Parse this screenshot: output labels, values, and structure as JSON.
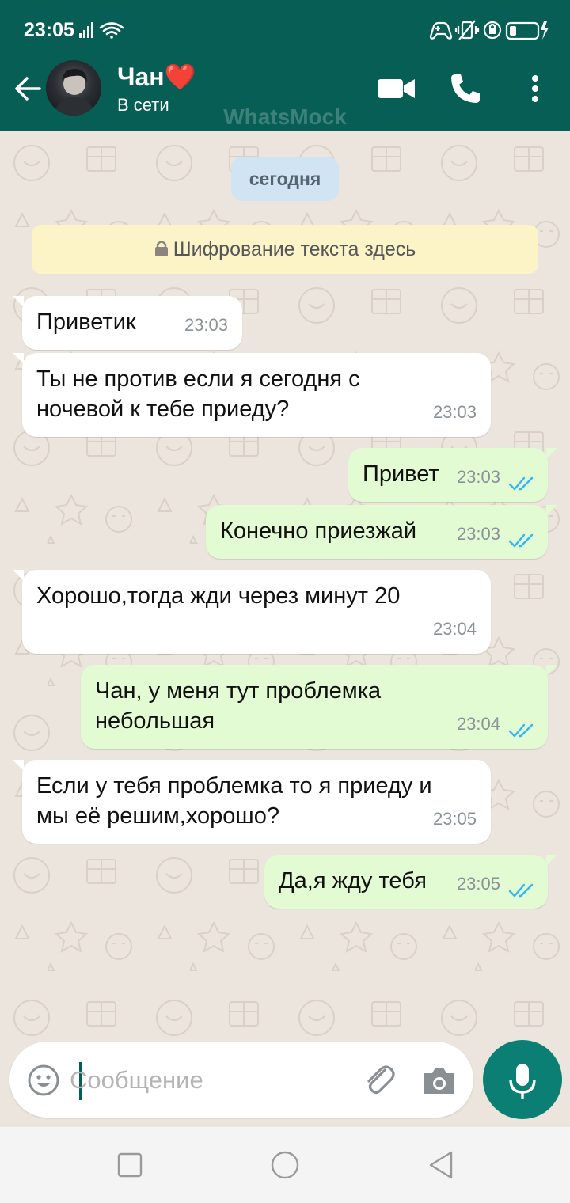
{
  "status_bar": {
    "time": "23:05",
    "icons_left": [
      "signal-icon",
      "wifi-icon"
    ],
    "icons_right": [
      "gamepad-icon",
      "vibrate-icon",
      "data-saver-icon",
      "battery-icon"
    ]
  },
  "header": {
    "contact_name": "Чан",
    "name_emoji": "❤️",
    "status": "В сети",
    "watermark": "WhatsMock",
    "icons": [
      "back-arrow-icon",
      "video-call-icon",
      "phone-call-icon",
      "more-vert-icon"
    ]
  },
  "chat": {
    "date_label": "сегодня",
    "encryption_notice": "Шифрование текста здесь",
    "messages": [
      {
        "dir": "in",
        "text": "Приветик",
        "time": "23:03"
      },
      {
        "dir": "in",
        "text": "Ты не против если я сегодня с ночевой к тебе приеду?",
        "time": "23:03"
      },
      {
        "dir": "out",
        "text": "Привет",
        "time": "23:03",
        "read": true
      },
      {
        "dir": "out",
        "text": "Конечно приезжай",
        "time": "23:03",
        "read": true
      },
      {
        "dir": "in",
        "text": "Хорошо,тогда жди через минут 20",
        "time": "23:04"
      },
      {
        "dir": "out",
        "text": "Чан, у меня тут проблемка небольшая",
        "time": "23:04",
        "read": true
      },
      {
        "dir": "in",
        "text": "Если у тебя проблемка то я приеду и мы её решим,хорошо?",
        "time": "23:05"
      },
      {
        "dir": "out",
        "text": "Да,я жду тебя",
        "time": "23:05",
        "read": true
      }
    ]
  },
  "composer": {
    "placeholder": "Сообщение",
    "value": ""
  },
  "colors": {
    "header": "#075e54",
    "outgoing_bubble": "#e2fbd3",
    "incoming_bubble": "#ffffff",
    "read_ticks": "#34b7f1",
    "mic_button": "#0b7f74"
  }
}
